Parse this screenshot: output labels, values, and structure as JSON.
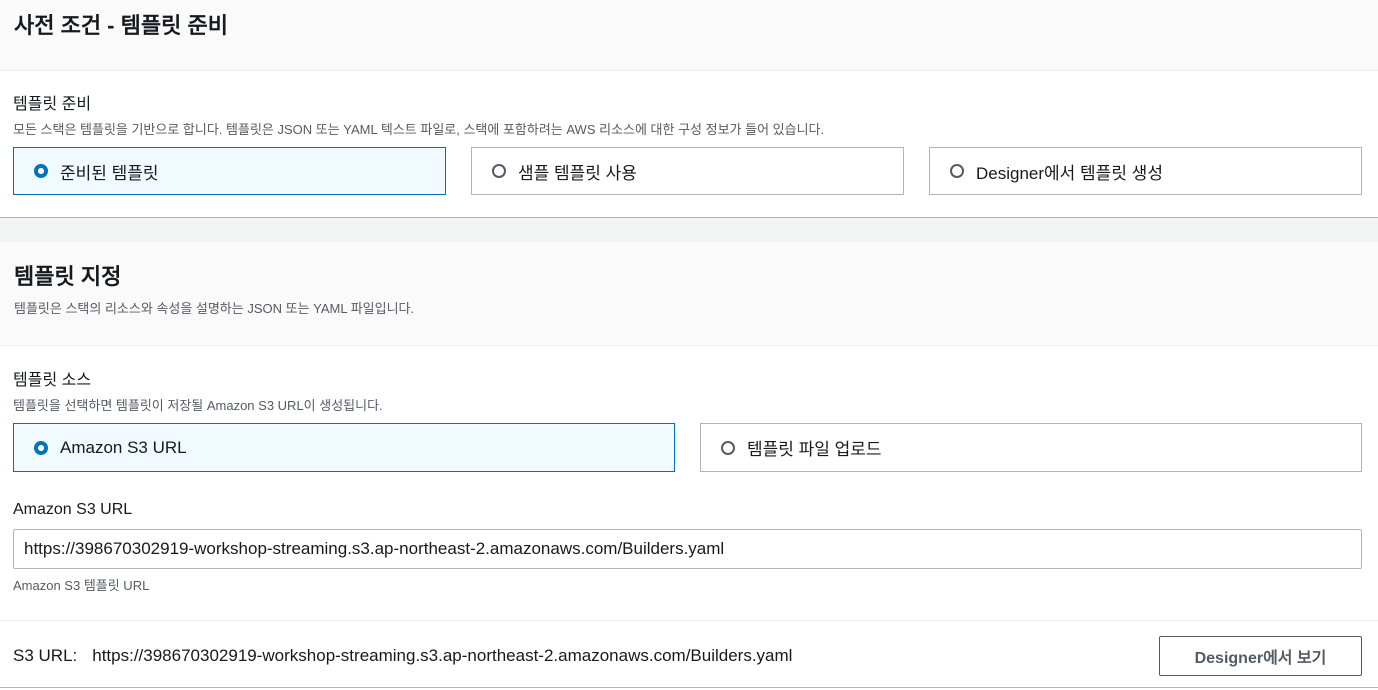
{
  "prereq": {
    "header": "사전 조건 - 템플릿 준비",
    "field_label": "템플릿 준비",
    "field_desc": "모든 스택은 템플릿을 기반으로 합니다. 템플릿은 JSON 또는 YAML 텍스트 파일로, 스택에 포함하려는 AWS 리소스에 대한 구성 정보가 들어 있습니다.",
    "options": [
      {
        "label": "준비된 템플릿",
        "selected": true
      },
      {
        "label": "샘플 템플릿 사용",
        "selected": false
      },
      {
        "label": "Designer에서 템플릿 생성",
        "selected": false
      }
    ]
  },
  "specify": {
    "header": "템플릿 지정",
    "header_desc": "템플릿은 스택의 리소스와 속성을 설명하는 JSON 또는 YAML 파일입니다.",
    "source_label": "템플릿 소스",
    "source_desc": "템플릿을 선택하면 템플릿이 저장될 Amazon S3 URL이 생성됩니다.",
    "source_options": [
      {
        "label": "Amazon S3 URL",
        "selected": true
      },
      {
        "label": "템플릿 파일 업로드",
        "selected": false
      }
    ],
    "url_label": "Amazon S3 URL",
    "url_value": "https://398670302919-workshop-streaming.s3.ap-northeast-2.amazonaws.com/Builders.yaml",
    "url_hint": "Amazon S3 템플릿 URL",
    "s3_url_label": "S3 URL:",
    "s3_url_value": "https://398670302919-workshop-streaming.s3.ap-northeast-2.amazonaws.com/Builders.yaml",
    "designer_button": "Designer에서 보기"
  },
  "colors": {
    "accent": "#0073bb",
    "selected_bg": "#f1faff",
    "border": "#aab7b8",
    "muted_text": "#545b64"
  }
}
